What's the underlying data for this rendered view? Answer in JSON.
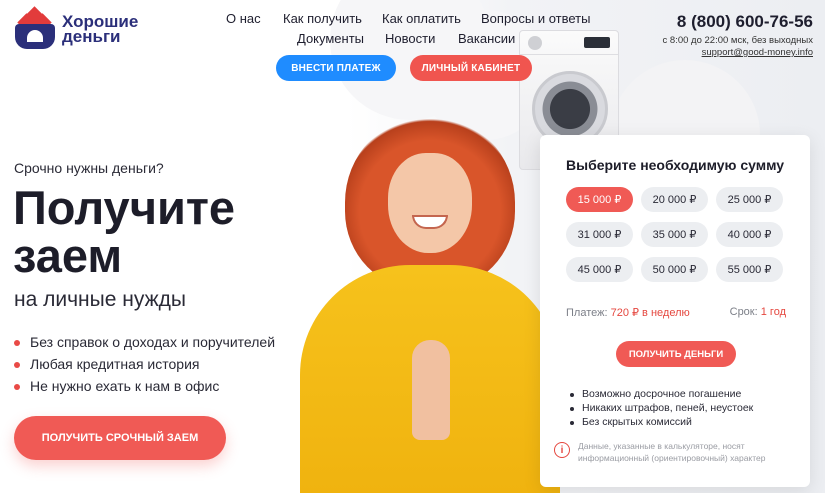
{
  "brand": {
    "name_line1": "Хорошие",
    "name_line2": "деньги"
  },
  "nav": {
    "row1": [
      "О нас",
      "Как получить",
      "Как оплатить",
      "Вопросы и ответы"
    ],
    "row2": [
      "Документы",
      "Новости",
      "Вакансии"
    ]
  },
  "header_buttons": {
    "pay": "Внести платеж",
    "cabinet": "Личный кабинет"
  },
  "contacts": {
    "phone": "8 (800) 600-76-56",
    "hours": "с 8:00 до 22:00 мск, без выходных",
    "email": "support@good-money.info"
  },
  "hero": {
    "kicker": "Срочно нужны деньги?",
    "title_line1": "Получите",
    "title_line2": "заем",
    "subtitle": "на личные нужды",
    "bullets": [
      "Без справок о доходах и поручителей",
      "Любая кредитная история",
      "Не нужно ехать к нам в офис"
    ],
    "cta": "Получить срочный заем"
  },
  "calculator": {
    "title": "Выберите необходимую сумму",
    "amounts": [
      "15 000 ₽",
      "20 000 ₽",
      "25 000 ₽",
      "31 000 ₽",
      "35 000 ₽",
      "40 000 ₽",
      "45 000 ₽",
      "50 000 ₽",
      "55 000 ₽"
    ],
    "selected_amount": "15 000 ₽",
    "payment_label": "Платеж:",
    "payment_value": "720 ₽ в неделю",
    "term_label": "Срок:",
    "term_value": "1 год",
    "cta": "Получить деньги",
    "perks": [
      "Возможно досрочное погашение",
      "Никаких штрафов, пеней, неустоек",
      "Без скрытых комиссий"
    ],
    "disclaimer_line1": "Данные, указанные в калькуляторе, носят",
    "disclaimer_line2": "информационный (ориентировочный) характер",
    "info_icon": "info-icon"
  },
  "colors": {
    "brand_navy": "#2b2f7a",
    "accent_red": "#f05a55",
    "accent_blue": "#1f8cff"
  }
}
